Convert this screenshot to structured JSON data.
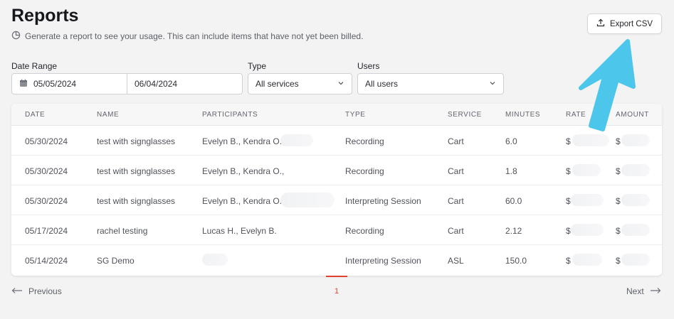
{
  "header": {
    "title": "Reports",
    "subtitle": "Generate a report to see your usage. This can include items that have not yet been billed.",
    "export_label": "Export CSV"
  },
  "filters": {
    "date_range_label": "Date Range",
    "date_start": "05/05/2024",
    "date_end": "06/04/2024",
    "type_label": "Type",
    "type_value": "All services",
    "users_label": "Users",
    "users_value": "All users"
  },
  "table": {
    "columns": [
      "DATE",
      "NAME",
      "PARTICIPANTS",
      "TYPE",
      "SERVICE",
      "MINUTES",
      "RATE",
      "AMOUNT"
    ],
    "rows": [
      {
        "date": "05/30/2024",
        "name": "test with signglasses",
        "participants": "Evelyn B., Kendra O.,",
        "type": "Recording",
        "service": "Cart",
        "minutes": "6.0",
        "rate": "$",
        "amount": "$"
      },
      {
        "date": "05/30/2024",
        "name": "test with signglasses",
        "participants": "Evelyn B., Kendra O.,",
        "type": "Recording",
        "service": "Cart",
        "minutes": "1.8",
        "rate": "$",
        "amount": "$"
      },
      {
        "date": "05/30/2024",
        "name": "test with signglasses",
        "participants": "Evelyn B., Kendra O.,",
        "type": "Interpreting Session",
        "service": "Cart",
        "minutes": "60.0",
        "rate": "$",
        "amount": "$"
      },
      {
        "date": "05/17/2024",
        "name": "rachel testing",
        "participants": "Lucas H., Evelyn B.",
        "type": "Recording",
        "service": "Cart",
        "minutes": "2.12",
        "rate": "$",
        "amount": "$"
      },
      {
        "date": "05/14/2024",
        "name": "SG Demo",
        "participants": "",
        "type": "Interpreting Session",
        "service": "ASL",
        "minutes": "150.0",
        "rate": "$",
        "amount": "$"
      }
    ]
  },
  "pagination": {
    "prev_label": "Previous",
    "next_label": "Next",
    "current_page": "1"
  },
  "colors": {
    "accent": "#e0422d",
    "annotation_arrow": "#4cc6ea"
  },
  "icons": [
    "pie-chart-icon",
    "upload-icon",
    "calendar-icon",
    "chevron-down-icon",
    "arrow-left-icon",
    "arrow-right-icon",
    "annotation-arrow-icon"
  ]
}
